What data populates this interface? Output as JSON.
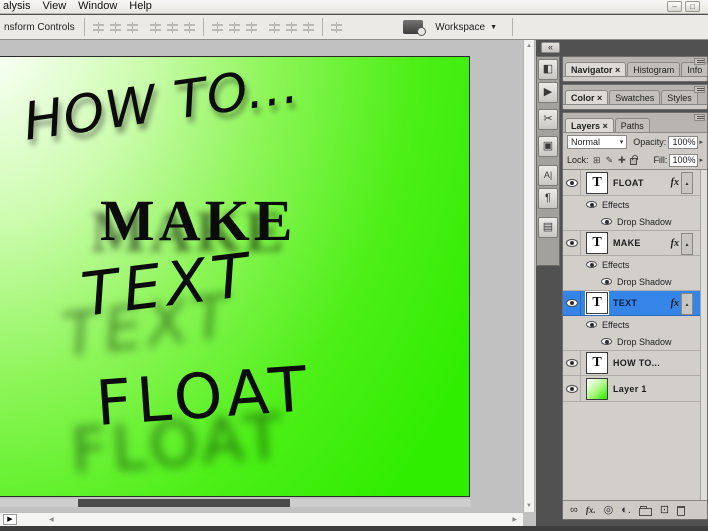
{
  "menu": {
    "items": [
      "alysis",
      "View",
      "Window",
      "Help"
    ]
  },
  "window_controls": {
    "minimize": "–",
    "restore": "□"
  },
  "options_bar": {
    "transform_controls_label": "nsform Controls",
    "workspace_label": "Workspace"
  },
  "canvas": {
    "lines": [
      "HOW TO...",
      "MAKE",
      "TEXT",
      "FLOAT"
    ],
    "background_top_left": "#ffffff",
    "background_bottom_right": "#2fee00",
    "text_color": "#0b0b0b"
  },
  "panels": {
    "navigator_group": {
      "tabs": [
        "Navigator ×",
        "Histogram",
        "Info"
      ]
    },
    "color_group": {
      "tabs": [
        "Color ×",
        "Swatches",
        "Styles"
      ]
    },
    "layers_group": {
      "tabs": [
        "Layers ×",
        "Paths"
      ],
      "blend_mode": "Normal",
      "opacity_label": "Opacity:",
      "opacity_value": "100%",
      "lock_label": "Lock:",
      "fill_label": "Fill:",
      "fill_value": "100%",
      "selection_color": "#3584e8",
      "rows": [
        {
          "name": "FLOAT",
          "thumb": "T",
          "fx": "fx"
        },
        {
          "name": "Effects"
        },
        {
          "name": "Drop Shadow"
        },
        {
          "name": "MAKE",
          "thumb": "T",
          "fx": "fx"
        },
        {
          "name": "Effects"
        },
        {
          "name": "Drop Shadow"
        },
        {
          "name": "TEXT",
          "thumb": "T",
          "fx": "fx",
          "selected": true
        },
        {
          "name": "Effects"
        },
        {
          "name": "Drop Shadow"
        },
        {
          "name": "HOW TO...",
          "thumb": "T"
        },
        {
          "name": "Layer 1",
          "thumb": ""
        }
      ]
    }
  },
  "icons": {
    "minimize": "–",
    "restore": "□",
    "collapse_dock": "«",
    "workspace_arrow": "▼",
    "dropdown_arrow": "▾",
    "spinner_arrow": "▸",
    "panel_btn_1": "◧",
    "panel_btn_2": "▶",
    "panel_btn_3": "✂",
    "panel_btn_4": "▣",
    "panel_btn_5": "A|",
    "panel_btn_6": "¶",
    "panel_btn_7": "▤",
    "lock_transparency": "⊞",
    "lock_paint": "✎",
    "lock_position": "✚",
    "link": "∞",
    "fx_footer": "fx.",
    "layer_mask": "◎",
    "adjustment_layer": "◐.",
    "new_layer": "⊡",
    "collapse_row": "▲",
    "scroll_up": "▲",
    "scroll_down": "▼",
    "scroll_left": "◀",
    "scroll_right": "▶",
    "status_play": "▶"
  }
}
